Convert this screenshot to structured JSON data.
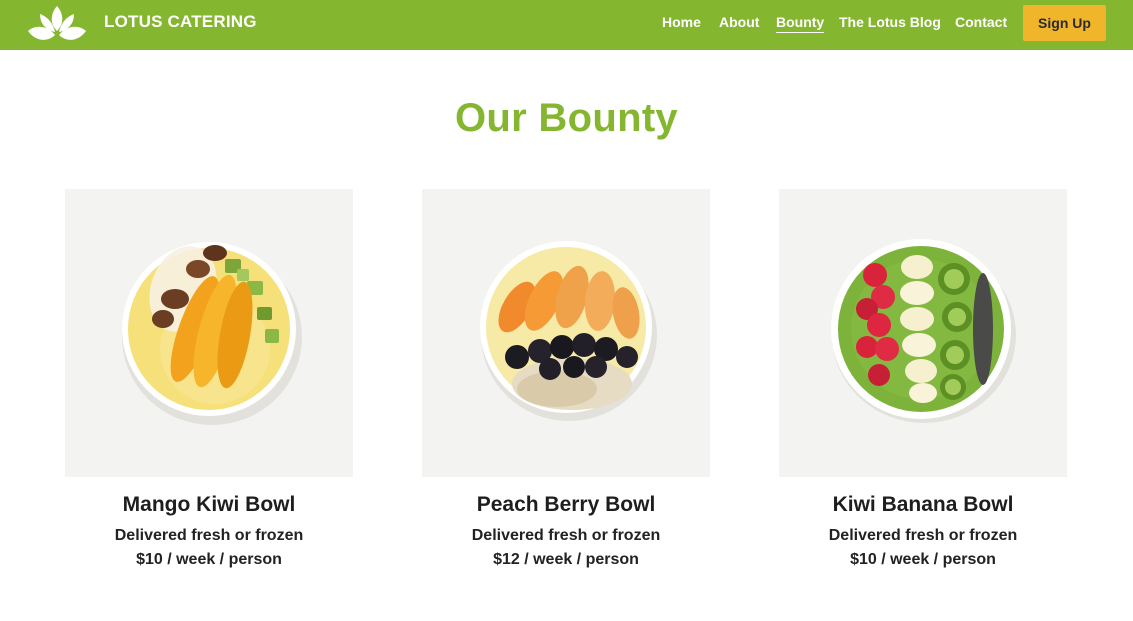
{
  "header": {
    "brand": "LOTUS CATERING",
    "logo_icon": "lotus-icon",
    "nav": [
      {
        "label": "Home"
      },
      {
        "label": "About"
      },
      {
        "label": "Bounty",
        "active": true
      },
      {
        "label": "The Lotus Blog"
      },
      {
        "label": "Contact"
      }
    ],
    "signup_label": "Sign Up"
  },
  "page": {
    "title": "Our Bounty"
  },
  "products": [
    {
      "name": "Mango Kiwi Bowl",
      "delivery": "Delivered fresh or frozen",
      "price": "$10 / week / person"
    },
    {
      "name": "Peach Berry Bowl",
      "delivery": "Delivered fresh or frozen",
      "price": "$12 / week / person"
    },
    {
      "name": "Kiwi Banana Bowl",
      "delivery": "Delivered fresh or frozen",
      "price": "$10 / week / person"
    }
  ],
  "colors": {
    "brand_green": "#85b62f",
    "button_yellow": "#f0b52a",
    "card_bg": "#f3f3f2"
  }
}
